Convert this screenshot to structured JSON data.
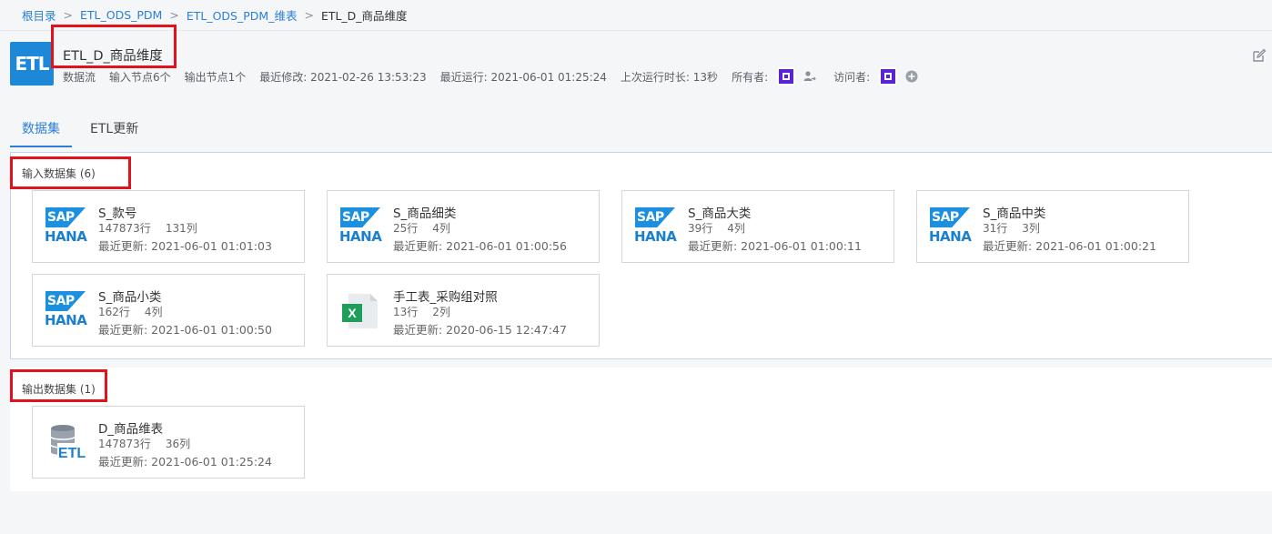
{
  "breadcrumb": {
    "items": [
      "根目录",
      "ETL_ODS_PDM",
      "ETL_ODS_PDM_维表"
    ],
    "current": "ETL_D_商品维度",
    "separator": ">"
  },
  "header": {
    "logo_text": "ETL",
    "title": "ETL_D_商品维度",
    "meta": {
      "type": "数据流",
      "input_nodes": "输入节点6个",
      "output_nodes": "输出节点1个",
      "modified": "最近修改: 2021-02-26 13:53:23",
      "last_run": "最近运行: 2021-06-01 01:25:24",
      "duration": "上次运行时长: 13秒",
      "owner_label": "所有者:",
      "visitor_label": "访问者:"
    }
  },
  "tabs": [
    {
      "label": "数据集",
      "active": true
    },
    {
      "label": "ETL更新",
      "active": false
    }
  ],
  "input_section": {
    "label": "输入数据集 (6)",
    "datasets": [
      {
        "name": "S_款号",
        "rows": "147873行",
        "cols": "131列",
        "updated": "最近更新: 2021-06-01 01:01:03",
        "icon": "sap-hana-icon"
      },
      {
        "name": "S_商品细类",
        "rows": "25行",
        "cols": "4列",
        "updated": "最近更新: 2021-06-01 01:00:56",
        "icon": "sap-hana-icon"
      },
      {
        "name": "S_商品大类",
        "rows": "39行",
        "cols": "4列",
        "updated": "最近更新: 2021-06-01 01:00:11",
        "icon": "sap-hana-icon"
      },
      {
        "name": "S_商品中类",
        "rows": "31行",
        "cols": "3列",
        "updated": "最近更新: 2021-06-01 01:00:21",
        "icon": "sap-hana-icon"
      },
      {
        "name": "S_商品小类",
        "rows": "162行",
        "cols": "4列",
        "updated": "最近更新: 2021-06-01 01:00:50",
        "icon": "sap-hana-icon"
      },
      {
        "name": "手工表_采购组对照",
        "rows": "13行",
        "cols": "2列",
        "updated": "最近更新: 2020-06-15 12:47:47",
        "icon": "excel-icon"
      }
    ]
  },
  "output_section": {
    "label": "输出数据集 (1)",
    "datasets": [
      {
        "name": "D_商品维表",
        "rows": "147873行",
        "cols": "36列",
        "updated": "最近更新: 2021-06-01 01:25:24",
        "icon": "etl-database-icon"
      }
    ]
  },
  "sap_logo": {
    "top": "SAP",
    "bottom": "HANA"
  },
  "excel_logo": {
    "letter": "X"
  },
  "db_logo": {
    "text": "ETL"
  },
  "colors": {
    "accent": "#2b7fd6",
    "highlight": "#e0121b",
    "avatar": "#5b21d6",
    "etl_logo": "#1e88d8"
  }
}
